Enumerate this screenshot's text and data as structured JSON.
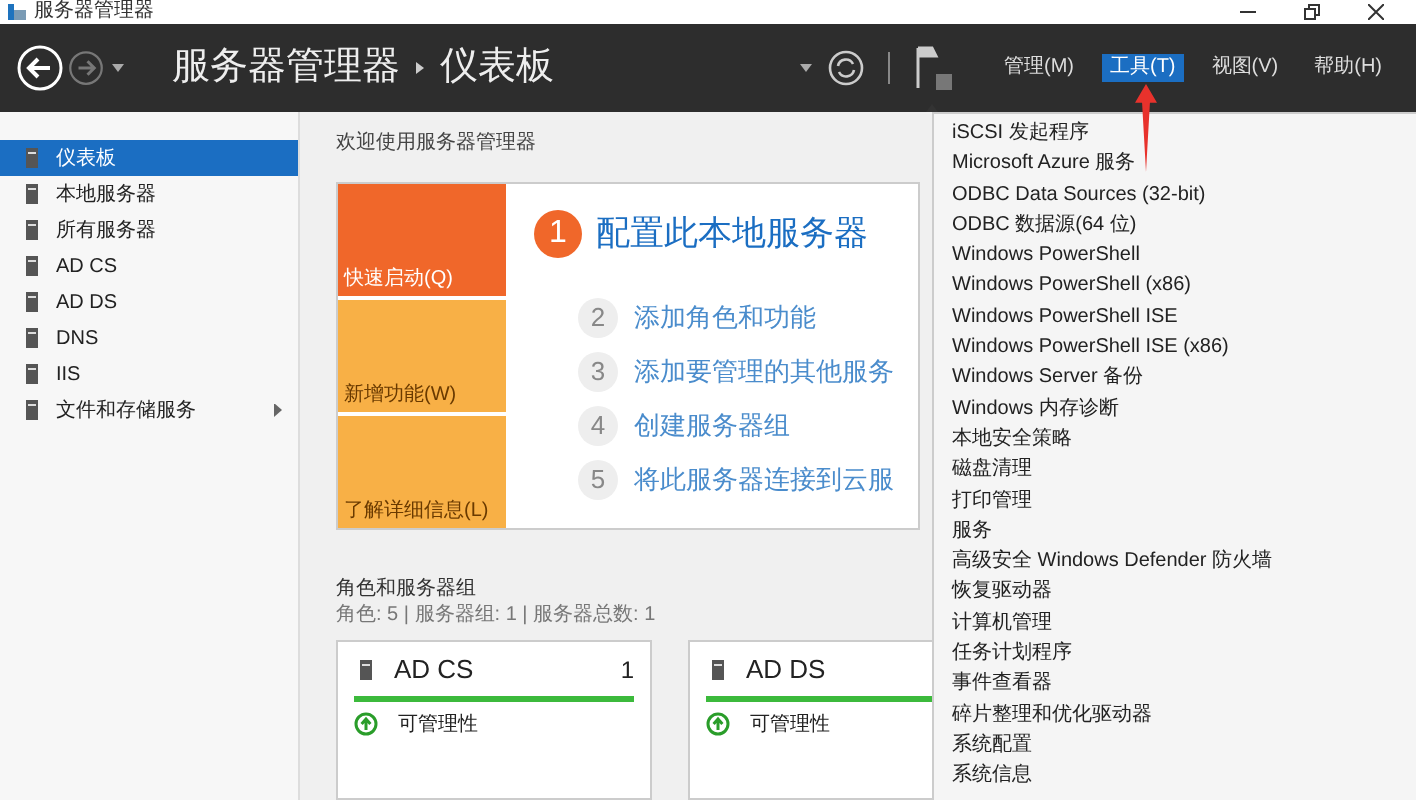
{
  "window": {
    "title": "服务器管理器"
  },
  "header": {
    "app": "服务器管理器",
    "page": "仪表板",
    "menus": [
      {
        "label": "管理(M)",
        "selected": false
      },
      {
        "label": "工具(T)",
        "selected": true
      },
      {
        "label": "视图(V)",
        "selected": false
      },
      {
        "label": "帮助(H)",
        "selected": false
      }
    ]
  },
  "sidebar": {
    "items": [
      {
        "label": "仪表板",
        "selected": true,
        "has_submenu": false
      },
      {
        "label": "本地服务器",
        "selected": false,
        "has_submenu": false
      },
      {
        "label": "所有服务器",
        "selected": false,
        "has_submenu": false
      },
      {
        "label": "AD CS",
        "selected": false,
        "has_submenu": false
      },
      {
        "label": "AD DS",
        "selected": false,
        "has_submenu": false
      },
      {
        "label": "DNS",
        "selected": false,
        "has_submenu": false
      },
      {
        "label": "IIS",
        "selected": false,
        "has_submenu": false
      },
      {
        "label": "文件和存储服务",
        "selected": false,
        "has_submenu": true
      }
    ]
  },
  "welcome": {
    "title": "欢迎使用服务器管理器",
    "tiles": [
      {
        "label": "快速启动(Q)",
        "kind": "active"
      },
      {
        "label": "新增功能(W)",
        "kind": "normal"
      },
      {
        "label": "了解详细信息(L)",
        "kind": "normal"
      }
    ],
    "steps": [
      {
        "number": "1",
        "label": "配置此本地服务器",
        "kind": "primary"
      },
      {
        "number": "2",
        "label": "添加角色和功能",
        "kind": "secondary"
      },
      {
        "number": "3",
        "label": "添加要管理的其他服务",
        "kind": "secondary"
      },
      {
        "number": "4",
        "label": "创建服务器组",
        "kind": "secondary"
      },
      {
        "number": "5",
        "label": "将此服务器连接到云服",
        "kind": "secondary"
      }
    ]
  },
  "roles": {
    "title": "角色和服务器组",
    "summary": "角色: 5 | 服务器组: 1 | 服务器总数: 1",
    "cards": [
      {
        "name": "AD CS",
        "count": "1",
        "status": "可管理性"
      },
      {
        "name": "AD DS",
        "status": "可管理性"
      }
    ]
  },
  "tools_menu": {
    "items": [
      "iSCSI 发起程序",
      "Microsoft Azure 服务",
      "ODBC Data Sources (32-bit)",
      "ODBC 数据源(64 位)",
      "Windows PowerShell",
      "Windows PowerShell (x86)",
      "Windows PowerShell ISE",
      "Windows PowerShell ISE (x86)",
      "Windows Server 备份",
      "Windows 内存诊断",
      "本地安全策略",
      "磁盘清理",
      "打印管理",
      "服务",
      "高级安全 Windows Defender 防火墙",
      "恢复驱动器",
      "计算机管理",
      "任务计划程序",
      "事件查看器",
      "碎片整理和优化驱动器",
      "系统配置",
      "系统信息"
    ]
  }
}
